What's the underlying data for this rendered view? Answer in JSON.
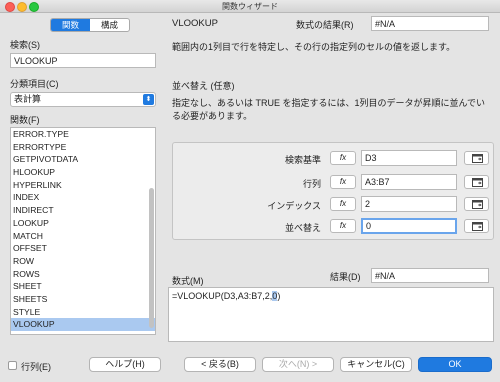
{
  "window": {
    "title": "関数ウィザード"
  },
  "tabs": [
    {
      "label": "関数"
    },
    {
      "label": "構成"
    }
  ],
  "search": {
    "label": "検索(S)",
    "value": "VLOOKUP"
  },
  "category": {
    "label": "分類項目(C)",
    "value": "表計算"
  },
  "functions": {
    "label": "関数(F)",
    "items": [
      "ERROR.TYPE",
      "ERRORTYPE",
      "GETPIVOTDATA",
      "HLOOKUP",
      "HYPERLINK",
      "INDEX",
      "INDIRECT",
      "LOOKUP",
      "MATCH",
      "OFFSET",
      "ROW",
      "ROWS",
      "SHEET",
      "SHEETS",
      "STYLE",
      "VLOOKUP"
    ],
    "selected": "VLOOKUP"
  },
  "detail": {
    "function_name": "VLOOKUP",
    "result_label": "数式の結果(R)",
    "result_value": "#N/A",
    "description": "範囲内の1列目で行を特定し、その行の指定列のセルの値を返します。",
    "arg_name": "並べ替え (任意)",
    "arg_description": "指定なし、あるいは TRUE を指定するには、1列目のデータが昇順に並んでいる必要があります。"
  },
  "arguments": [
    {
      "label": "検索基準",
      "fx": "fx",
      "value": "D3"
    },
    {
      "label": "行列",
      "fx": "fx",
      "value": "A3:B7"
    },
    {
      "label": "インデックス",
      "fx": "fx",
      "value": "2"
    },
    {
      "label": "並べ替え",
      "fx": "fx",
      "value": "0"
    }
  ],
  "formula": {
    "label": "数式(M)",
    "prefix": "=VLOOKUP(D3,A3:B7,2,",
    "selected": "0",
    "suffix": ")",
    "result_label": "結果(D)",
    "result_value": "#N/A"
  },
  "footer": {
    "array_label": "行列(E)",
    "help": "ヘルプ(H)",
    "back": "< 戻る(B)",
    "next": "次へ(N) >",
    "cancel": "キャンセル(C)",
    "ok": "OK"
  }
}
